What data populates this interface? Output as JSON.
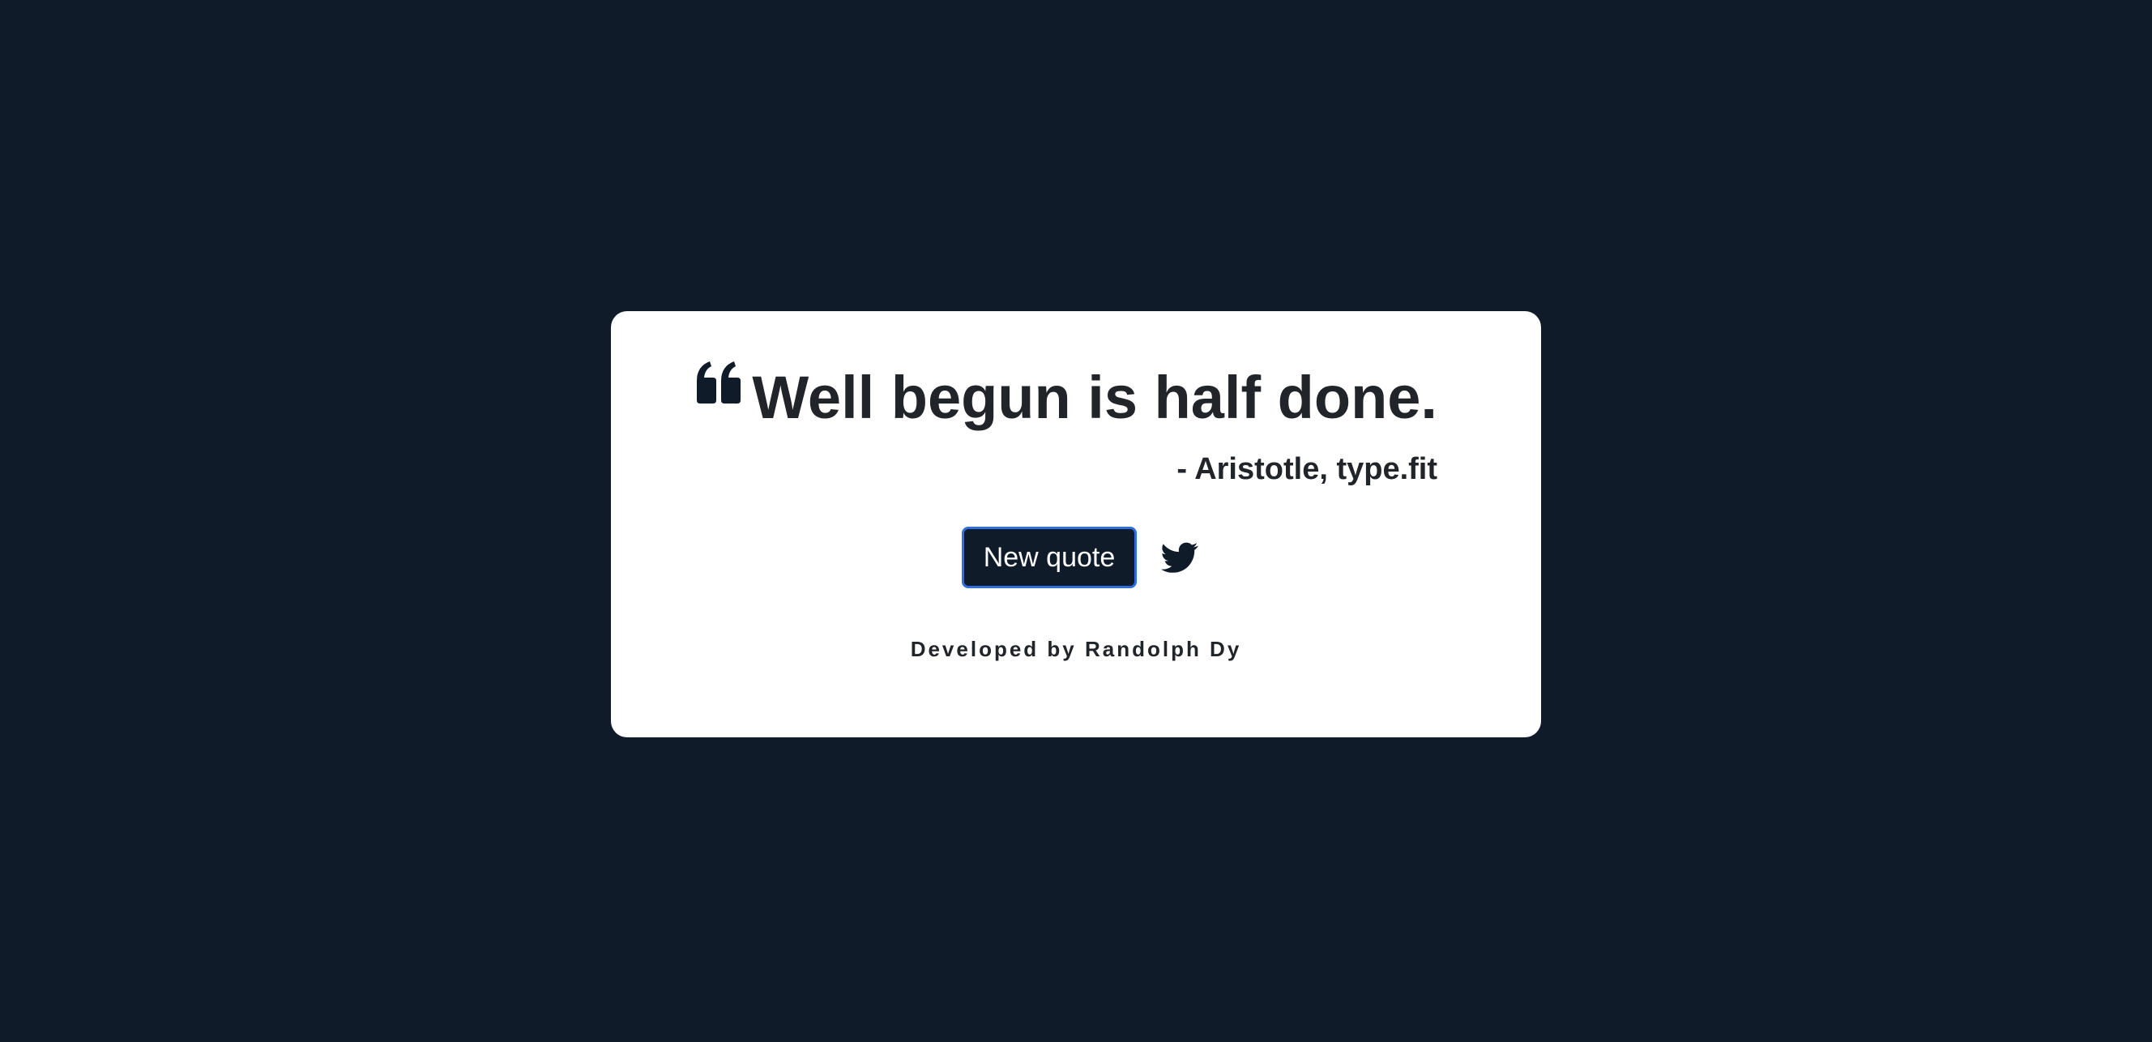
{
  "quote": {
    "text": "Well begun is half done.",
    "author": "- Aristotle, type.fit"
  },
  "actions": {
    "new_quote_label": "New quote",
    "tweet_icon": "twitter-icon"
  },
  "footer": {
    "credit": "Developed by Randolph Dy"
  },
  "colors": {
    "background": "#101b2a",
    "card": "#ffffff",
    "text": "#212428",
    "button_border": "#2f6fdb"
  }
}
